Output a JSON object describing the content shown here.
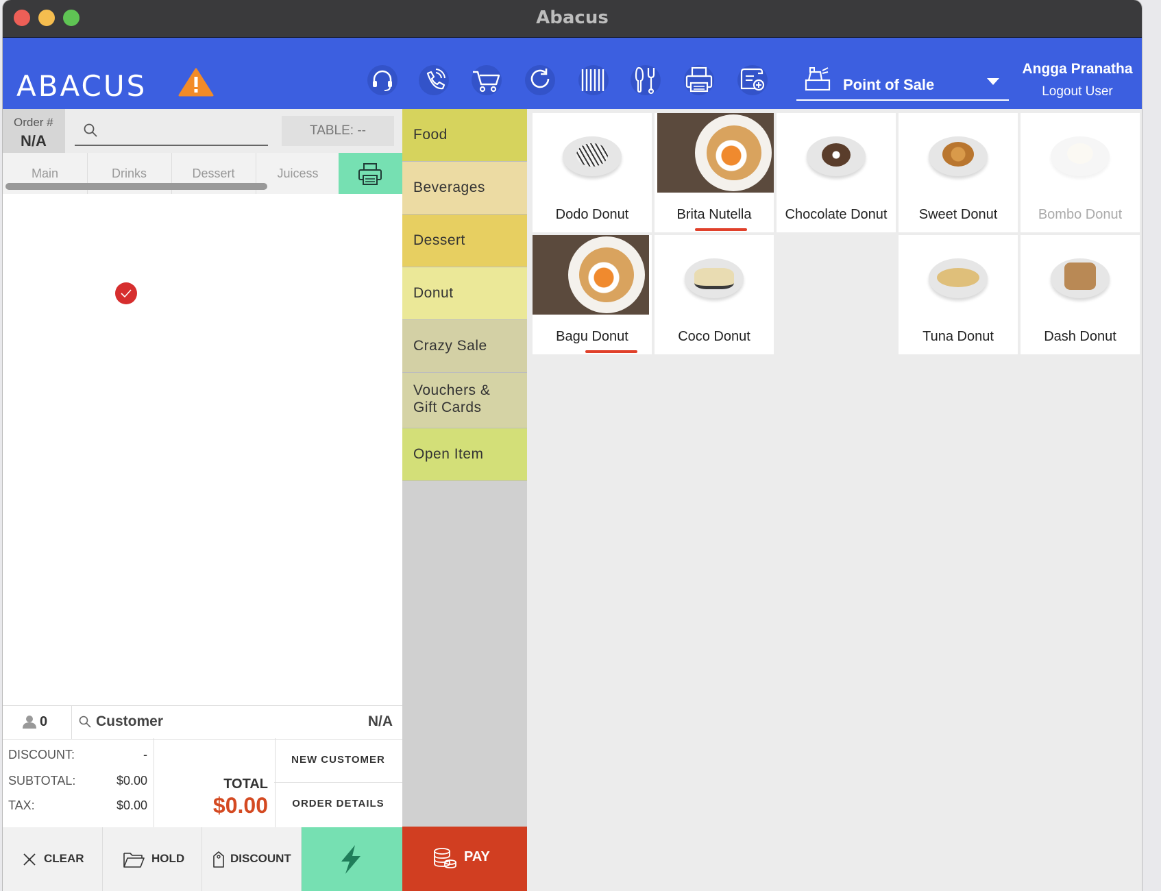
{
  "window": {
    "title": "Abacus"
  },
  "topbar": {
    "logo": "ABACUS",
    "mode_select": "Point of Sale",
    "user_name": "Angga Pranatha",
    "logout": "Logout User",
    "icons": [
      "headset-icon",
      "phone-icon",
      "cart-icon",
      "refresh-icon",
      "barcode-icon",
      "kitchen-icon",
      "printer-icon",
      "receipt-add-icon"
    ]
  },
  "order": {
    "label": "Order #",
    "value": "N/A",
    "table": "TABLE: --",
    "tabs": [
      "Main",
      "Drinks",
      "Dessert",
      "Juicess"
    ]
  },
  "customer": {
    "guest_count": "0",
    "label": "Customer",
    "value": "N/A"
  },
  "summary": {
    "discount_label": "DISCOUNT:",
    "discount_value": "-",
    "subtotal_label": "SUBTOTAL:",
    "subtotal_value": "$0.00",
    "tax_label": "TAX:",
    "tax_value": "$0.00",
    "total_label": "TOTAL",
    "total_value": "$0.00",
    "new_customer": "NEW CUSTOMER",
    "order_details": "ORDER DETAILS"
  },
  "actions": {
    "clear": "CLEAR",
    "hold": "HOLD",
    "discount": "DISCOUNT",
    "pay": "PAY"
  },
  "categories": [
    {
      "label": "Food",
      "color": "#d6d35d"
    },
    {
      "label": "Beverages",
      "color": "#ecdba3"
    },
    {
      "label": "Dessert",
      "color": "#e7cf61"
    },
    {
      "label": "Donut",
      "color": "#ebe898",
      "selected": true
    },
    {
      "label": "Crazy Sale",
      "color": "#d3d0a5"
    },
    {
      "label": "Vouchers &",
      "label2": "Gift Cards",
      "color": "#d5d3a5"
    },
    {
      "label": "Open Item",
      "color": "#d3df78"
    }
  ],
  "products": [
    {
      "name": "Dodo Donut"
    },
    {
      "name": "Brita Nutella",
      "in_order": true
    },
    {
      "name": "Chocolate Donut"
    },
    {
      "name": "Sweet Donut"
    },
    {
      "name": "Bombo Donut",
      "disabled": true
    },
    {
      "name": "Bagu Donut",
      "in_order": true
    },
    {
      "name": "Coco Donut"
    },
    {
      "name": "Tuna Donut"
    },
    {
      "name": "Dash Donut"
    }
  ],
  "colors": {
    "accent": "#3c5fe0",
    "pay": "#d13e21",
    "success": "#76e0b2",
    "total": "#d44a22"
  }
}
